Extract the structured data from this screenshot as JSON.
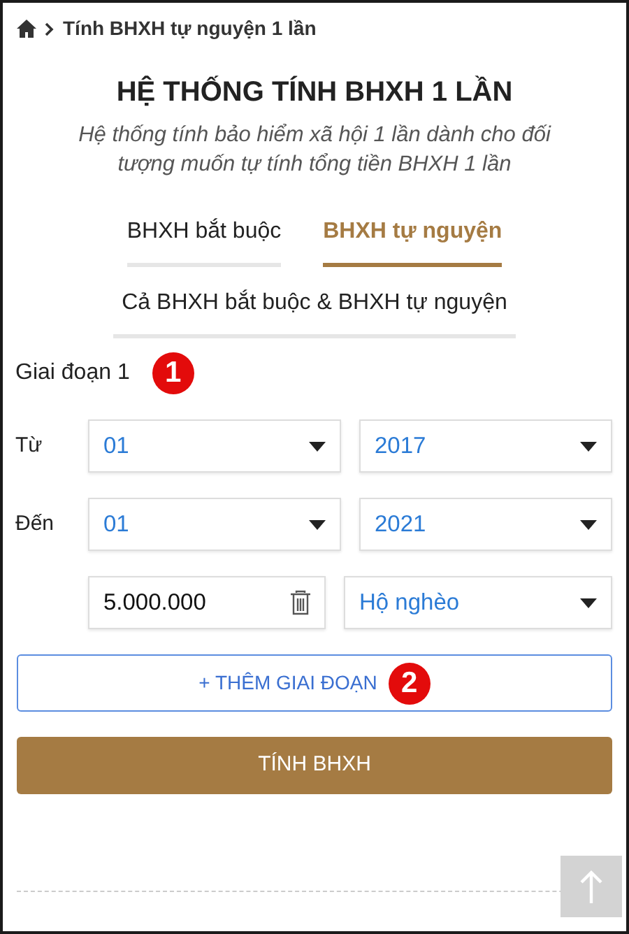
{
  "breadcrumb": {
    "current": "Tính BHXH tự nguyện 1 lần"
  },
  "title": "HỆ THỐNG TÍNH BHXH 1 LẦN",
  "subtitle": "Hệ thống tính bảo hiểm xã hội 1 lần dành cho đối tượng muốn tự tính tổng tiền BHXH 1 lần",
  "tabs": [
    {
      "label": "BHXH bắt buộc",
      "selected": false
    },
    {
      "label": "BHXH tự nguyện",
      "selected": true
    },
    {
      "label": "Cả BHXH bắt buộc & BHXH tự nguyện",
      "selected": false
    }
  ],
  "period": {
    "label": "Giai đoạn 1",
    "marker": "1",
    "rows": [
      {
        "label": "Từ",
        "month": "01",
        "year": "2017"
      },
      {
        "label": "Đến",
        "month": "01",
        "year": "2021"
      }
    ],
    "amount": "5.000.000",
    "household": "Hộ nghèo"
  },
  "add_button": {
    "label": "+ THÊM GIAI ĐOẠN",
    "marker": "2"
  },
  "submit_button": "TÍNH BHXH"
}
